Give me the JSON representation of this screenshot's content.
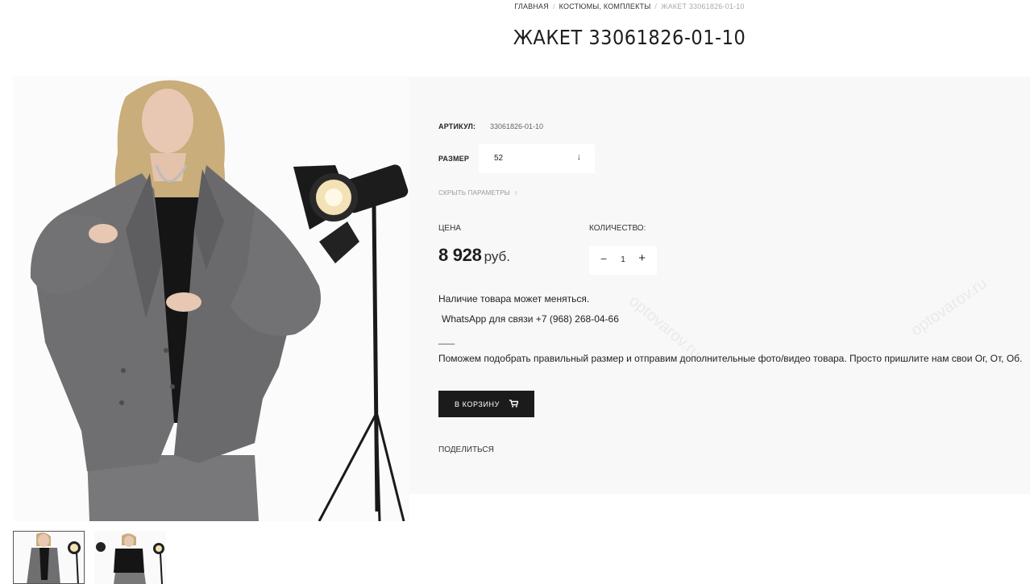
{
  "breadcrumb": {
    "home": "ГЛАВНАЯ",
    "category": "КОСТЮМЫ, КОМПЛЕКТЫ",
    "current": "ЖАКЕТ 33061826-01-10",
    "separator": "/"
  },
  "product": {
    "title": "ЖАКЕТ 33061826-01-10",
    "sku_label": "АРТИКУЛ:",
    "sku_value": "33061826-01-10",
    "size_label": "РАЗМЕР",
    "size_value": "52",
    "hide_params_label": "СКРЫТЬ ПАРАМЕТРЫ",
    "price_label": "ЦЕНА",
    "price_value": "8 928",
    "currency": "руб.",
    "quantity_label": "КОЛИЧЕСТВО:",
    "quantity_value": "1",
    "description": {
      "line1": "Наличие товара может меняться.",
      "line2": "WhatsApp для связи +7 (968) 268-04-66",
      "line3": "___",
      "line4": "Поможем подобрать правильный размер и отправим дополнительные фото/видео товара. Просто пришлите нам свои Ог, От, Об."
    },
    "cart_button_label": "В КОРЗИНУ",
    "share_label": "ПОДЕЛИТЬСЯ"
  },
  "watermark_text": "optovarov.ru",
  "icons": {
    "select_arrow": "↓",
    "hide_arrow": "↑",
    "minus": "−",
    "plus": "+",
    "cart": "cart-icon"
  },
  "colors": {
    "accent": "#1b1b1b",
    "panel_bg": "#f8f8f8",
    "jacket": "#6f6f71",
    "text": "#222222"
  }
}
